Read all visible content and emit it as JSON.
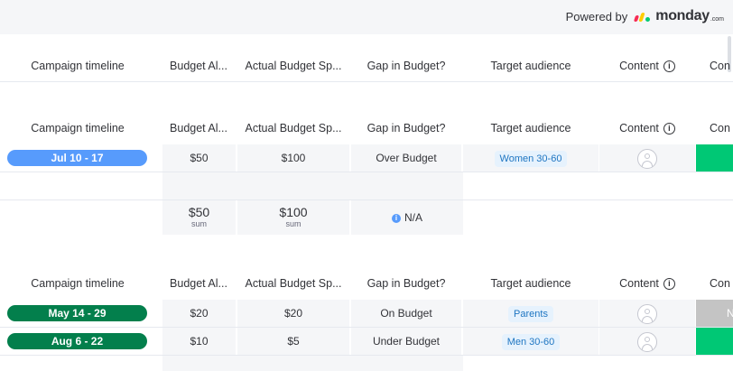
{
  "powered_by": {
    "label": "Powered by",
    "brand": "monday",
    "suffix": ".com",
    "logo_colors": [
      "#f62b54",
      "#ffcc00",
      "#00ca72"
    ]
  },
  "columns": {
    "timeline": "Campaign timeline",
    "budget_alloc": "Budget Al...",
    "actual_budget": "Actual Budget Sp...",
    "gap": "Gap in Budget?",
    "audience": "Target audience",
    "content": "Content",
    "next": "Con"
  },
  "groups": [
    {
      "rows": [
        {
          "timeline": "Jul 10 - 17",
          "timeline_color": "#579bfc",
          "budget": "$50",
          "actual": "$100",
          "gap": "Over Budget",
          "audience": "Women 30-60",
          "status_color": "#00c875",
          "status_text": ""
        }
      ],
      "summary": {
        "budget": "$50",
        "budget_label": "sum",
        "actual": "$100",
        "actual_label": "sum",
        "gap": "N/A"
      }
    },
    {
      "rows": [
        {
          "timeline": "May 14 - 29",
          "timeline_color": "#037f4c",
          "budget": "$20",
          "actual": "$20",
          "gap": "On Budget",
          "audience": "Parents",
          "status_color": "#c4c4c4",
          "status_text": "N"
        },
        {
          "timeline": "Aug 6 - 22",
          "timeline_color": "#037f4c",
          "budget": "$10",
          "actual": "$5",
          "gap": "Under Budget",
          "audience": "Men 30-60",
          "status_color": "#00c875",
          "status_text": ""
        }
      ]
    }
  ]
}
